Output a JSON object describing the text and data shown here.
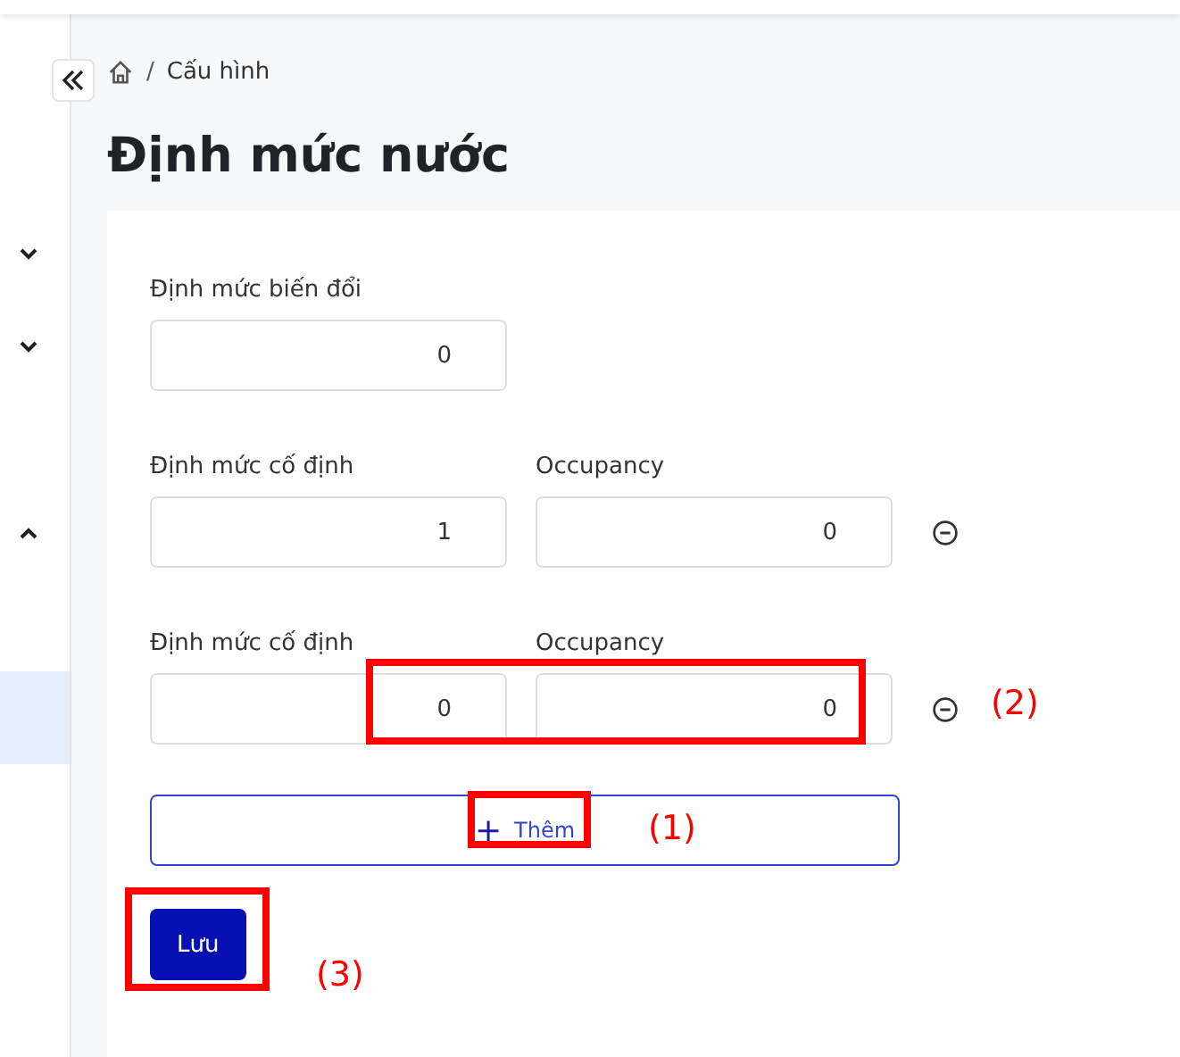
{
  "sidebar": {
    "items": [
      {
        "kind": "group",
        "expanded": false
      },
      {
        "kind": "group",
        "expanded": false
      },
      {
        "kind": "spacer"
      },
      {
        "kind": "group",
        "expanded": true,
        "children": [
          {
            "selected": false
          },
          {
            "selected": true
          }
        ]
      }
    ]
  },
  "breadcrumb": {
    "separator": "/",
    "items": [
      "Cấu hình"
    ]
  },
  "title": "Định mức nước",
  "form": {
    "variable": {
      "label": "Định mức biến đổi",
      "value": "0"
    },
    "fixed_rows": [
      {
        "fixed_label": "Định mức cố định",
        "fixed_value": "1",
        "occupancy_label": "Occupancy",
        "occupancy_value": "0"
      },
      {
        "fixed_label": "Định mức cố định",
        "fixed_value": "0",
        "occupancy_label": "Occupancy",
        "occupancy_value": "0"
      }
    ],
    "add_button": {
      "icon": "+",
      "label": "Thêm"
    },
    "save_button": "Lưu"
  },
  "annotations": [
    {
      "label": "(1)"
    },
    {
      "label": "(2)"
    },
    {
      "label": "(3)"
    }
  ]
}
